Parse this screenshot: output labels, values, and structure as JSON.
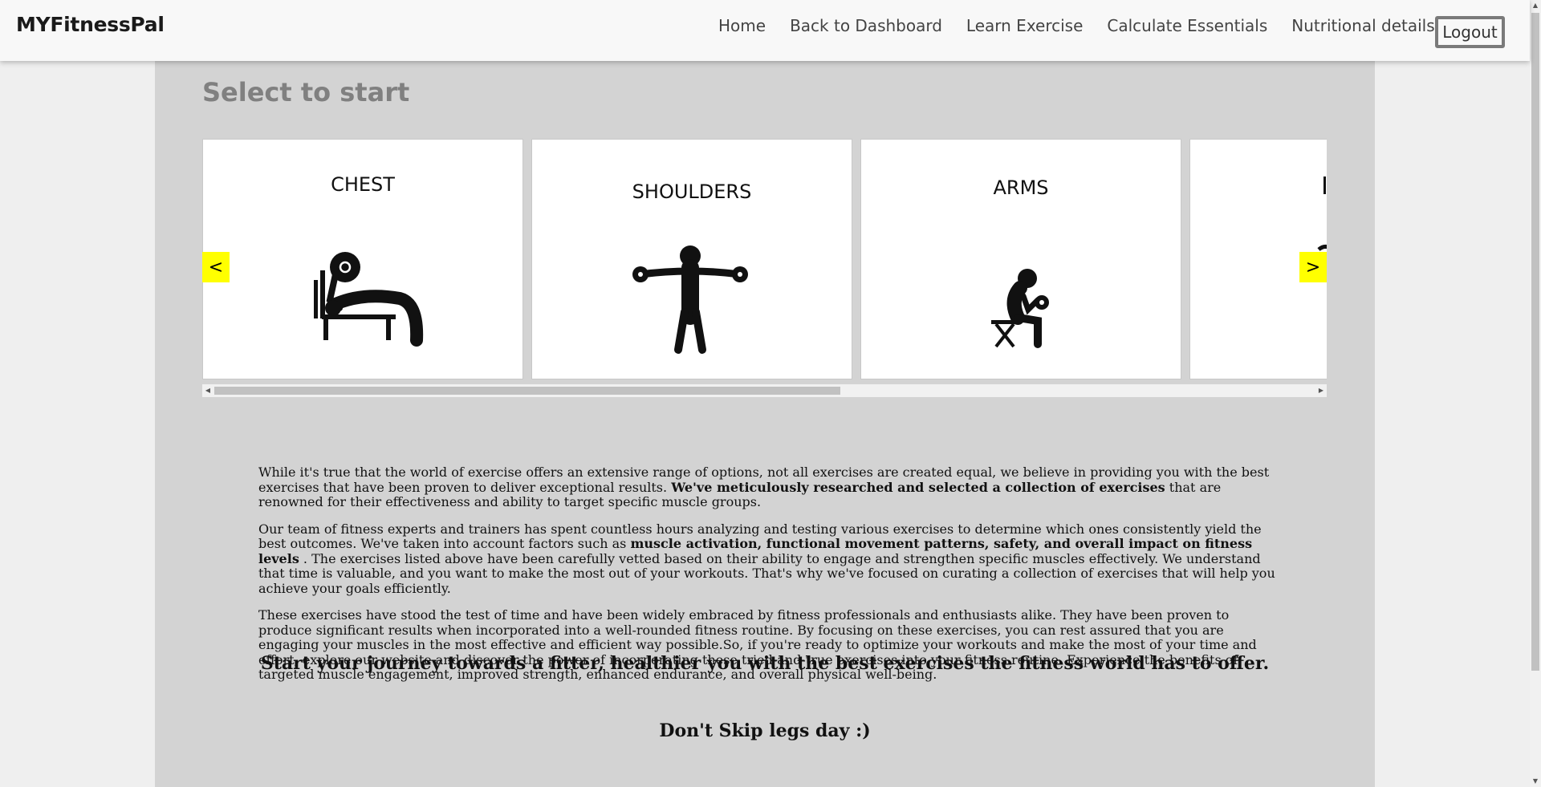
{
  "navbar": {
    "brand": "MYFitnessPal",
    "links": [
      "Home",
      "Back to Dashboard",
      "Learn Exercise",
      "Calculate Essentials",
      "Nutritional details"
    ],
    "logout": "Logout"
  },
  "section": {
    "title": "Select to start"
  },
  "carousel": {
    "cards": [
      {
        "label": "CHEST",
        "icon": "bench-press-icon"
      },
      {
        "label": "SHOULDERS",
        "icon": "lateral-raise-icon"
      },
      {
        "label": "ARMS",
        "icon": "seated-curl-icon"
      },
      {
        "label": "",
        "icon": "partial-card-icon"
      }
    ],
    "prev": "<",
    "next": ">"
  },
  "intro": {
    "p1_a": "While it's true that the world of exercise offers an extensive range of options, not all exercises are created equal, we believe in providing you with the best exercises that have been proven to deliver exceptional results.",
    "p1_b": "We've meticulously researched and selected a collection of exercises",
    "p1_c": "that are renowned for their effectiveness and ability to target specific muscle groups.",
    "p2_a": "Our team of fitness experts and trainers has spent countless hours analyzing and testing various exercises to determine which ones consistently yield the best outcomes. We've taken into account factors such as",
    "p2_b": "muscle activation, functional movement patterns, safety, and overall impact on fitness levels",
    "p2_c": ". The exercises listed above have been carefully vetted based on their ability to engage and strengthen specific muscles effectively. We understand that time is valuable, and you want to make the most out of your workouts. That's why we've focused on curating a collection of exercises that will help you achieve your goals efficiently.",
    "p3": "These exercises have stood the test of time and have been widely embraced by fitness professionals and enthusiasts alike. They have been proven to produce significant results when incorporated into a well-rounded fitness routine. By focusing on these exercises, you can rest assured that you are engaging your muscles in the most effective and efficient way possible.So, if you're ready to optimize your workouts and make the most of your time and effort, explore our website and discover the power of incorporating these tried-and-true exercises into your fitness routine. Experience the benefits of targeted muscle engagement, improved strength, enhanced endurance, and overall physical well-being."
  },
  "tagline": "Start your journey towards a fitter, healthier you with the best exercises the fitness world has to offer.",
  "legs": "Don't Skip legs day :)",
  "colors": {
    "accent_arrow": "#ffff00",
    "content_bg": "#d3d3d3",
    "title_gray": "#808080"
  }
}
